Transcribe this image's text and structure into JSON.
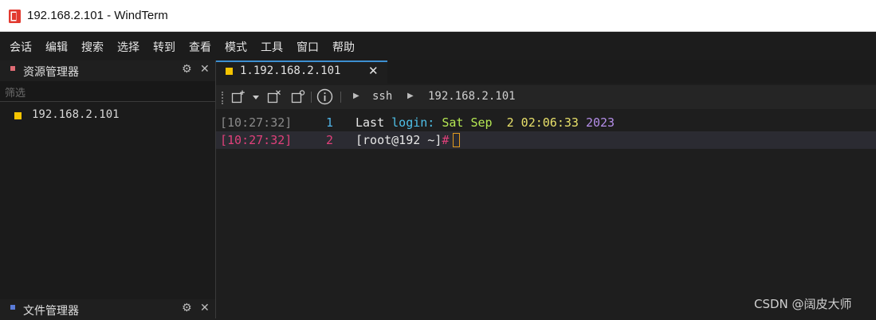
{
  "window": {
    "title": "192.168.2.101 - WindTerm",
    "app_icon": "windterm-app-icon",
    "app_icon_color": "#e23a30"
  },
  "menu": {
    "items": [
      "会话",
      "编辑",
      "搜索",
      "选择",
      "转到",
      "查看",
      "模式",
      "工具",
      "窗口",
      "帮助"
    ]
  },
  "explorer": {
    "title": "资源管理器",
    "dot_color": "#e06c75",
    "gear_icon": "gear-icon",
    "close_glyph": "✕",
    "gear_glyph": "⚙",
    "filter_placeholder": "筛选",
    "sessions": [
      {
        "label": "192.168.2.101",
        "color": "#f5c400"
      }
    ]
  },
  "file_manager": {
    "title": "文件管理器",
    "dot_color": "#5a7bd8",
    "gear_glyph": "⚙",
    "close_glyph": "✕"
  },
  "tabs": [
    {
      "label": "1.192.168.2.101",
      "close_glyph": "✕",
      "active": true,
      "color": "#f5c400"
    }
  ],
  "toolbar": {
    "icons": [
      "new-session-icon",
      "dropdown-icon",
      "close-session-icon",
      "duplicate-session-icon",
      "info-icon"
    ],
    "breadcrumb": [
      "ssh",
      "192.168.2.101"
    ]
  },
  "terminal": {
    "lines": [
      {
        "time": "[10:27:32]",
        "number": "1",
        "segments": [
          {
            "text": "Last ",
            "color": "#e6e6e6"
          },
          {
            "text": "login:",
            "color": "#4fc1e9"
          },
          {
            "text": " ",
            "color": "#e6e6e6"
          },
          {
            "text": "Sat Sep",
            "color": "#b5e853"
          },
          {
            "text": "  2 02:06:33 ",
            "color": "#e8e06a"
          },
          {
            "text": "2023",
            "color": "#b48ee8"
          }
        ]
      },
      {
        "time": "[10:27:32]",
        "number": "2",
        "active": true,
        "segments": [
          {
            "text": "[root@192 ~]",
            "color": "#e6e6e6"
          },
          {
            "text": "#",
            "color": "#e0407a"
          }
        ]
      }
    ],
    "colors": {
      "time": "#8a8a8a",
      "time_active": "#e0407a",
      "number": "#4fb3e6",
      "number_active": "#e0407a",
      "cursor": "#e09a1e"
    }
  },
  "watermark": "CSDN @阔皮大师"
}
